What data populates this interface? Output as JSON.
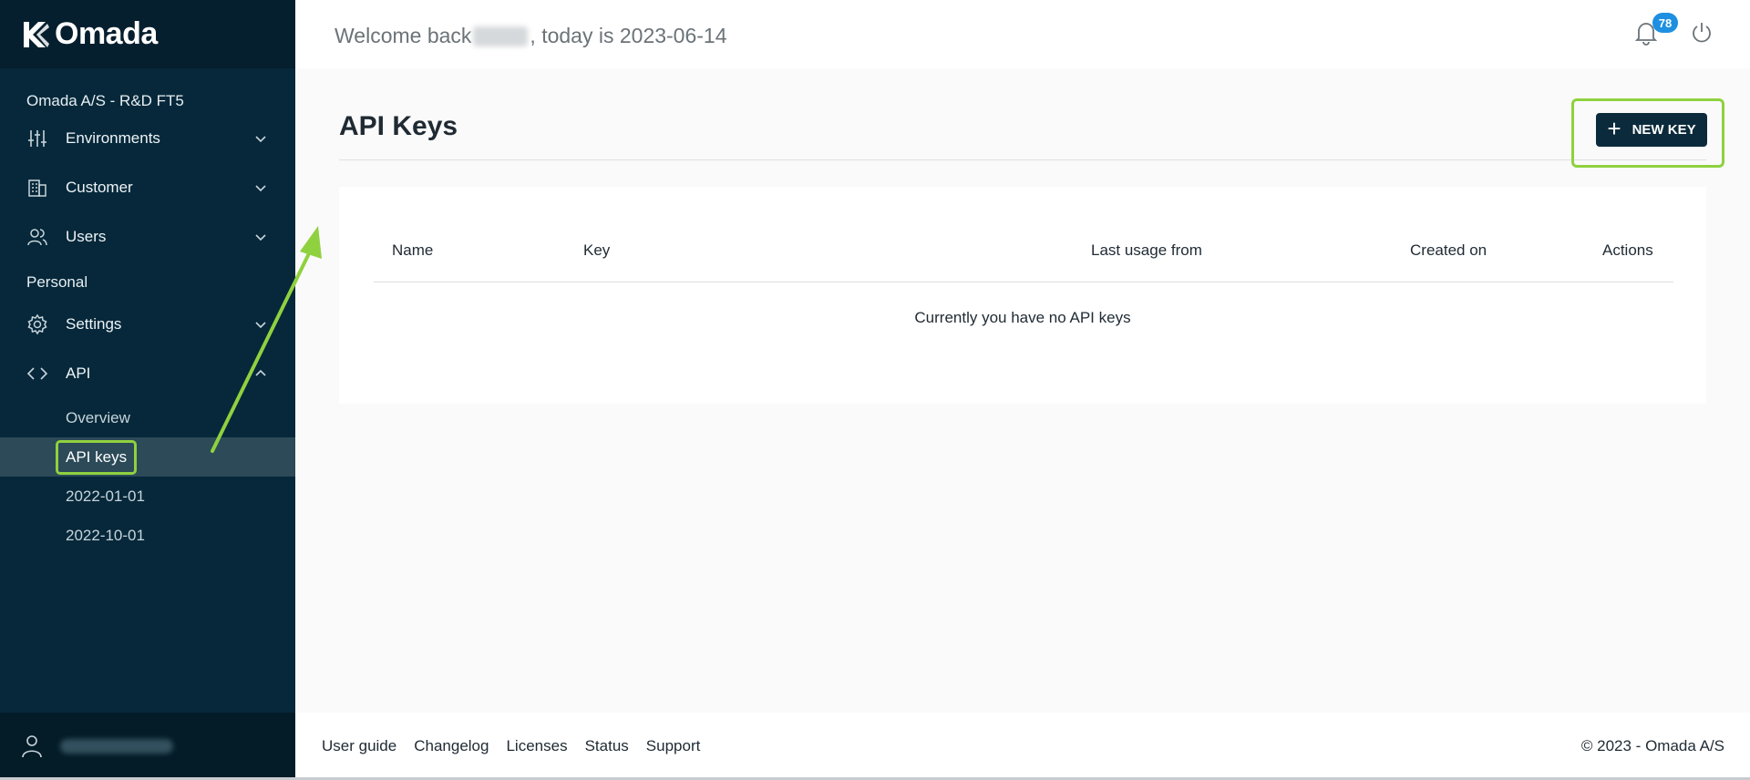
{
  "brand": {
    "name": "Omada"
  },
  "sidebar": {
    "org": "Omada A/S - R&D FT5",
    "items": [
      {
        "label": "Environments",
        "icon": "sliders-icon"
      },
      {
        "label": "Customer",
        "icon": "building-icon"
      },
      {
        "label": "Users",
        "icon": "users-icon"
      }
    ],
    "section_personal": "Personal",
    "personal_items": [
      {
        "label": "Settings",
        "icon": "gear-icon"
      },
      {
        "label": "API",
        "icon": "code-icon"
      }
    ],
    "api_sub_items": [
      "Overview",
      "API keys",
      "2022-01-01",
      "2022-10-01"
    ]
  },
  "header": {
    "welcome_prefix": "Welcome back",
    "welcome_suffix": ", today is 2023-06-14",
    "notification_count": "78"
  },
  "main": {
    "title": "API Keys",
    "new_key_label": "NEW KEY",
    "table": {
      "columns": [
        "Name",
        "Key",
        "Last usage from",
        "Created on",
        "Actions"
      ],
      "empty_message": "Currently you have no API keys"
    }
  },
  "footer": {
    "links": [
      "User guide",
      "Changelog",
      "Licenses",
      "Status",
      "Support"
    ],
    "copyright": "© 2023 - Omada A/S"
  },
  "colors": {
    "sidebar": "#06283a",
    "highlight": "#8fd13f",
    "badge": "#1e8fe1",
    "button": "#0b2b3c"
  }
}
